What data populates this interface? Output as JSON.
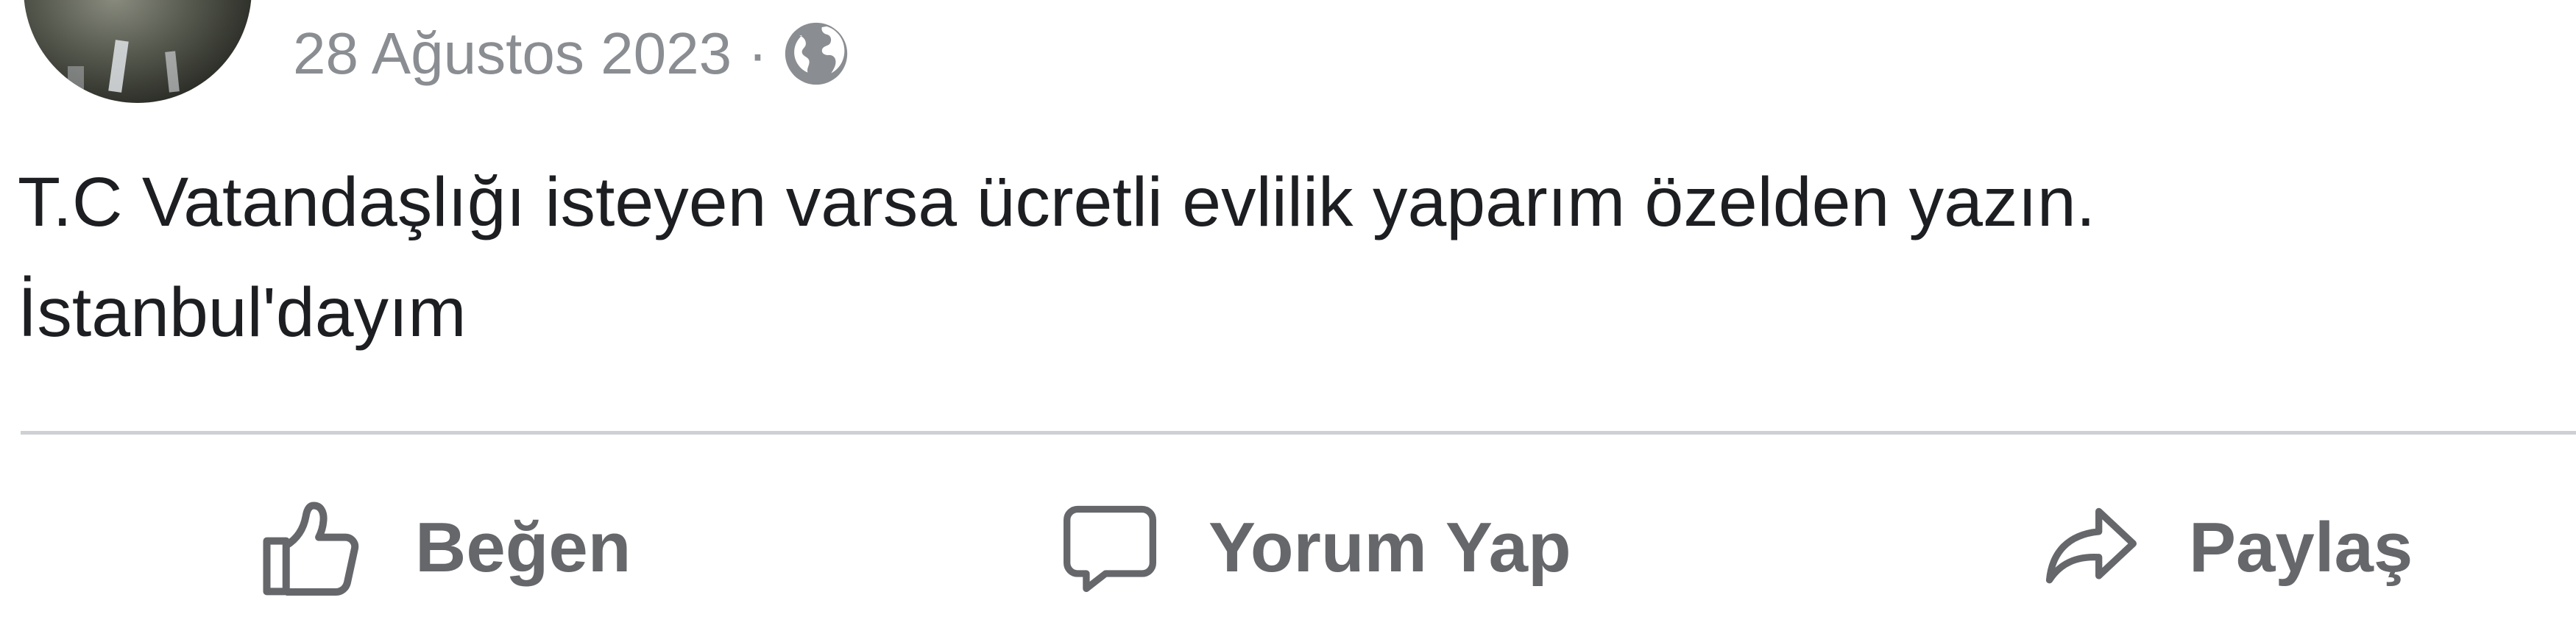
{
  "post": {
    "date": "28 Ağustos 2023",
    "separator": "·",
    "privacy_icon": "globe-icon",
    "text_lines": [
      "T.C Vatandaşlığı isteyen varsa ücretli evlilik yaparım özelden yazın.",
      "İstanbul'dayım"
    ]
  },
  "actions": {
    "like": {
      "label": "Beğen",
      "icon": "thumbs-up-icon"
    },
    "comment": {
      "label": "Yorum Yap",
      "icon": "comment-icon"
    },
    "share": {
      "label": "Paylaş",
      "icon": "share-icon"
    }
  },
  "colors": {
    "meta_text": "#8a8d91",
    "body_text": "#1c1e21",
    "action_text": "#65676b",
    "divider": "#ced0d4"
  }
}
